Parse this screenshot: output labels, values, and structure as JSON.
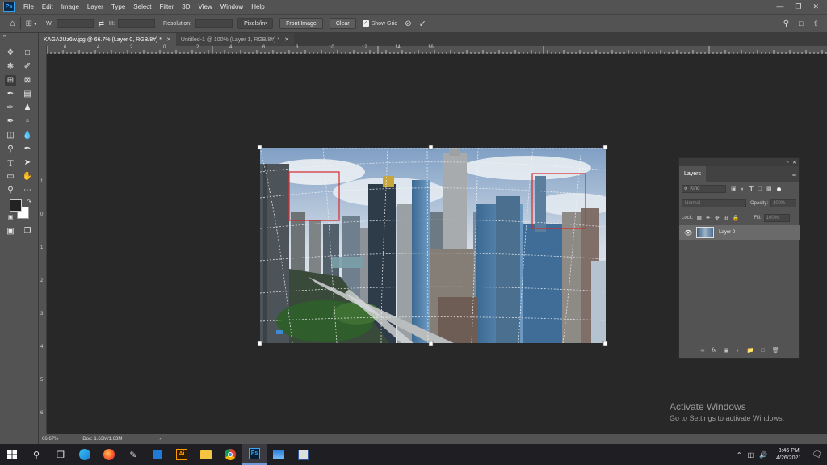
{
  "menubar": {
    "logo": "Ps",
    "items": [
      "File",
      "Edit",
      "Image",
      "Layer",
      "Type",
      "Select",
      "Filter",
      "3D",
      "View",
      "Window",
      "Help"
    ]
  },
  "options": {
    "w_label": "W:",
    "h_label": "H:",
    "resolution_label": "Resolution:",
    "units_value": "Pixels/in",
    "front_image": "Front Image",
    "clear": "Clear",
    "show_grid": "Show Grid"
  },
  "tabs": [
    {
      "label": "KAGA2Uz6w.jpg @ 66.7% (Layer 0, RGB/8#) *",
      "active": true
    },
    {
      "label": "Untitled-1 @ 100% (Layer 1, RGB/8#) *",
      "active": false
    }
  ],
  "ruler_top": [
    "6",
    "4",
    "2",
    "0",
    "2",
    "4",
    "6",
    "8",
    "10",
    "12",
    "14",
    "16"
  ],
  "ruler_left": [
    "1",
    "0",
    "1",
    "2",
    "3",
    "4",
    "5",
    "6"
  ],
  "status": {
    "zoom": "66.67%",
    "doc": "Doc: 1.63M/1.63M"
  },
  "layers_panel": {
    "tab": "Layers",
    "kind_placeholder": "Kind",
    "blend_mode": "Normal",
    "opacity_label": "Opacity:",
    "opacity_value": "100%",
    "lock_label": "Lock:",
    "fill_label": "Fill:",
    "fill_value": "100%",
    "layers": [
      {
        "name": "Layer 0",
        "visible": true
      }
    ]
  },
  "watermark": {
    "title": "Activate Windows",
    "subtitle": "Go to Settings to activate Windows."
  },
  "taskbar": {
    "time": "3:46 PM",
    "date": "4/26/2021"
  },
  "colors": {
    "ps_blue": "#31a8ff",
    "selection_red": "#d62a2a"
  }
}
